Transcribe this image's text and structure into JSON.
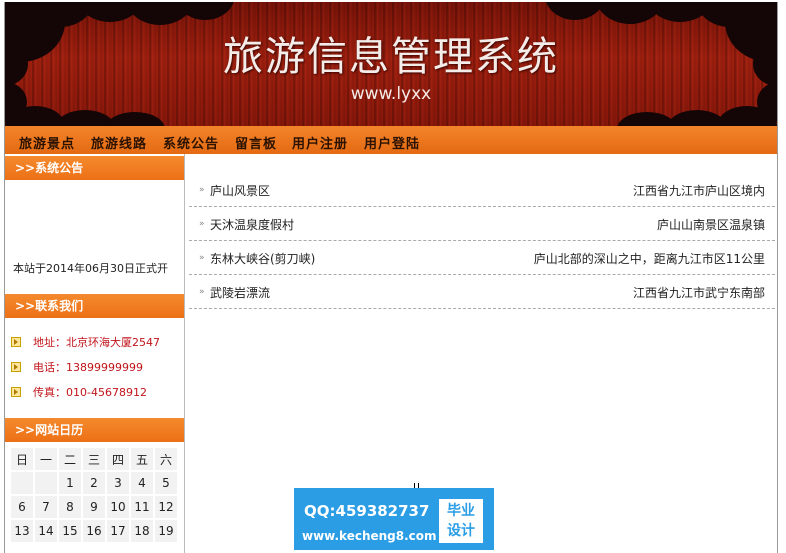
{
  "banner": {
    "title": "旅游信息管理系统",
    "subtitle": "www.lyxx"
  },
  "nav": {
    "items": [
      "旅游景点",
      "旅游线路",
      "系统公告",
      "留言板",
      "用户注册",
      "用户登陆"
    ]
  },
  "sidebar": {
    "notice": {
      "heading": ">>系统公告",
      "text": "本站于2014年06月30日正式开"
    },
    "contact": {
      "heading": ">>联系我们",
      "rows": [
        {
          "label": "地址：北京环海大厦2547"
        },
        {
          "label": "电话：13899999999"
        },
        {
          "label": "传真：010-45678912"
        }
      ]
    },
    "calendar": {
      "heading": ">>网站日历",
      "weekdays": [
        "日",
        "一",
        "二",
        "三",
        "四",
        "五",
        "六"
      ],
      "weeks": [
        [
          "",
          "",
          "1",
          "2",
          "3",
          "4",
          "5"
        ],
        [
          "6",
          "7",
          "8",
          "9",
          "10",
          "11",
          "12"
        ],
        [
          "13",
          "14",
          "15",
          "16",
          "17",
          "18",
          "19"
        ]
      ]
    }
  },
  "main": {
    "items": [
      {
        "arrow": "»",
        "name": "庐山风景区",
        "location": "江西省九江市庐山区境内"
      },
      {
        "arrow": "»",
        "name": "天沐温泉度假村",
        "location": "庐山山南景区温泉镇"
      },
      {
        "arrow": "»",
        "name": "东林大峡谷(剪刀峡)",
        "location": "庐山北部的深山之中，距离九江市区11公里"
      },
      {
        "arrow": "»",
        "name": "武陵岩漂流",
        "location": "江西省九江市武宁东南部"
      }
    ]
  },
  "ad": {
    "qq": "QQ:459382737",
    "url": "www.kecheng8.com",
    "badge_line1": "毕业",
    "badge_line2": "设计"
  }
}
